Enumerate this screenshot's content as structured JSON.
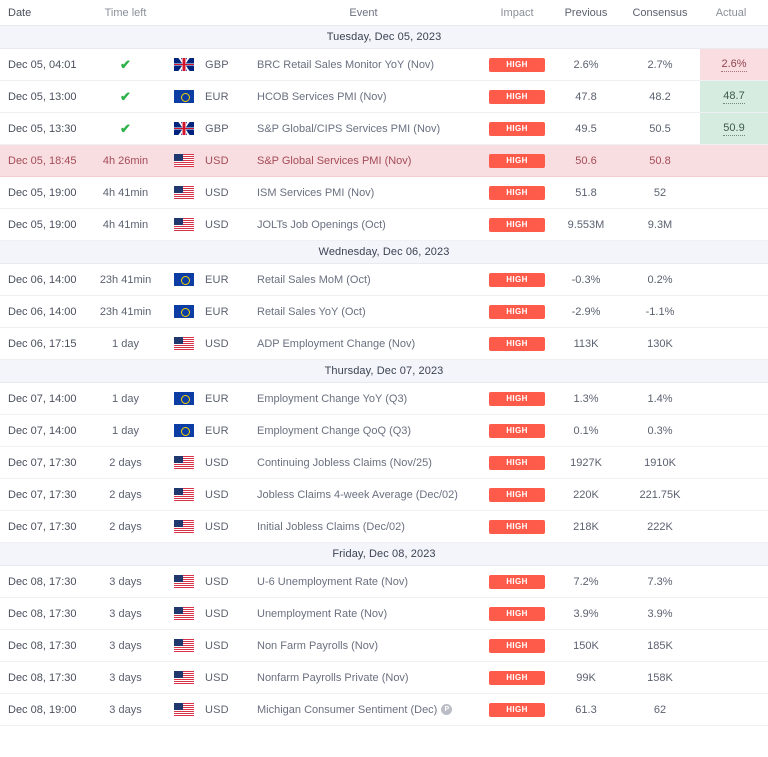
{
  "table": {
    "columns": {
      "date": "Date",
      "time_left": "Time left",
      "event": "Event",
      "impact": "Impact",
      "previous": "Previous",
      "consensus": "Consensus",
      "actual": "Actual"
    }
  },
  "colors": {
    "impact_high_badge": "#ff5b4a",
    "highlight_row_bg": "#f9dee1",
    "actual_beat_bg": "#d6ece1",
    "actual_miss_bg": "#fadde0",
    "day_separator_bg": "#f3f5fa",
    "check_green": "#2fb34a"
  },
  "sections": [
    {
      "day_label": "Tuesday, Dec 05, 2023",
      "rows": [
        {
          "date": "Dec 05, 04:01",
          "time_left": "",
          "released": true,
          "flag": "gb-flag-icon",
          "currency": "GBP",
          "event": "BRC Retail Sales Monitor YoY (Nov)",
          "impact": "HIGH",
          "previous": "2.6%",
          "consensus": "2.7%",
          "actual": "2.6%",
          "actual_state": "miss",
          "prelim": false,
          "highlight": false
        },
        {
          "date": "Dec 05, 13:00",
          "time_left": "",
          "released": true,
          "flag": "eu-flag-icon",
          "currency": "EUR",
          "event": "HCOB Services PMI (Nov)",
          "impact": "HIGH",
          "previous": "47.8",
          "consensus": "48.2",
          "actual": "48.7",
          "actual_state": "beat",
          "prelim": false,
          "highlight": false
        },
        {
          "date": "Dec 05, 13:30",
          "time_left": "",
          "released": true,
          "flag": "gb-flag-icon",
          "currency": "GBP",
          "event": "S&P Global/CIPS Services PMI (Nov)",
          "impact": "HIGH",
          "previous": "49.5",
          "consensus": "50.5",
          "actual": "50.9",
          "actual_state": "beat",
          "prelim": false,
          "highlight": false
        },
        {
          "date": "Dec 05, 18:45",
          "time_left": "4h 26min",
          "released": false,
          "flag": "us-flag-icon",
          "currency": "USD",
          "event": "S&P Global Services PMI (Nov)",
          "impact": "HIGH",
          "previous": "50.6",
          "consensus": "50.8",
          "actual": "",
          "actual_state": "blank",
          "prelim": false,
          "highlight": true
        },
        {
          "date": "Dec 05, 19:00",
          "time_left": "4h 41min",
          "released": false,
          "flag": "us-flag-icon",
          "currency": "USD",
          "event": "ISM Services PMI (Nov)",
          "impact": "HIGH",
          "previous": "51.8",
          "consensus": "52",
          "actual": "",
          "actual_state": "blank",
          "prelim": false,
          "highlight": false
        },
        {
          "date": "Dec 05, 19:00",
          "time_left": "4h 41min",
          "released": false,
          "flag": "us-flag-icon",
          "currency": "USD",
          "event": "JOLTs Job Openings (Oct)",
          "impact": "HIGH",
          "previous": "9.553M",
          "consensus": "9.3M",
          "actual": "",
          "actual_state": "blank",
          "prelim": false,
          "highlight": false
        }
      ]
    },
    {
      "day_label": "Wednesday, Dec 06, 2023",
      "rows": [
        {
          "date": "Dec 06, 14:00",
          "time_left": "23h 41min",
          "released": false,
          "flag": "eu-flag-icon",
          "currency": "EUR",
          "event": "Retail Sales MoM (Oct)",
          "impact": "HIGH",
          "previous": "-0.3%",
          "consensus": "0.2%",
          "actual": "",
          "actual_state": "blank",
          "prelim": false,
          "highlight": false
        },
        {
          "date": "Dec 06, 14:00",
          "time_left": "23h 41min",
          "released": false,
          "flag": "eu-flag-icon",
          "currency": "EUR",
          "event": "Retail Sales YoY (Oct)",
          "impact": "HIGH",
          "previous": "-2.9%",
          "consensus": "-1.1%",
          "actual": "",
          "actual_state": "blank",
          "prelim": false,
          "highlight": false
        },
        {
          "date": "Dec 06, 17:15",
          "time_left": "1 day",
          "released": false,
          "flag": "us-flag-icon",
          "currency": "USD",
          "event": "ADP Employment Change (Nov)",
          "impact": "HIGH",
          "previous": "113K",
          "consensus": "130K",
          "actual": "",
          "actual_state": "blank",
          "prelim": false,
          "highlight": false
        }
      ]
    },
    {
      "day_label": "Thursday, Dec 07, 2023",
      "rows": [
        {
          "date": "Dec 07, 14:00",
          "time_left": "1 day",
          "released": false,
          "flag": "eu-flag-icon",
          "currency": "EUR",
          "event": "Employment Change YoY (Q3)",
          "impact": "HIGH",
          "previous": "1.3%",
          "consensus": "1.4%",
          "actual": "",
          "actual_state": "blank",
          "prelim": false,
          "highlight": false
        },
        {
          "date": "Dec 07, 14:00",
          "time_left": "1 day",
          "released": false,
          "flag": "eu-flag-icon",
          "currency": "EUR",
          "event": "Employment Change QoQ (Q3)",
          "impact": "HIGH",
          "previous": "0.1%",
          "consensus": "0.3%",
          "actual": "",
          "actual_state": "blank",
          "prelim": false,
          "highlight": false
        },
        {
          "date": "Dec 07, 17:30",
          "time_left": "2 days",
          "released": false,
          "flag": "us-flag-icon",
          "currency": "USD",
          "event": "Continuing Jobless Claims (Nov/25)",
          "impact": "HIGH",
          "previous": "1927K",
          "consensus": "1910K",
          "actual": "",
          "actual_state": "blank",
          "prelim": false,
          "highlight": false
        },
        {
          "date": "Dec 07, 17:30",
          "time_left": "2 days",
          "released": false,
          "flag": "us-flag-icon",
          "currency": "USD",
          "event": "Jobless Claims 4-week Average (Dec/02)",
          "impact": "HIGH",
          "previous": "220K",
          "consensus": "221.75K",
          "actual": "",
          "actual_state": "blank",
          "prelim": false,
          "highlight": false
        },
        {
          "date": "Dec 07, 17:30",
          "time_left": "2 days",
          "released": false,
          "flag": "us-flag-icon",
          "currency": "USD",
          "event": "Initial Jobless Claims (Dec/02)",
          "impact": "HIGH",
          "previous": "218K",
          "consensus": "222K",
          "actual": "",
          "actual_state": "blank",
          "prelim": false,
          "highlight": false
        }
      ]
    },
    {
      "day_label": "Friday, Dec 08, 2023",
      "rows": [
        {
          "date": "Dec 08, 17:30",
          "time_left": "3 days",
          "released": false,
          "flag": "us-flag-icon",
          "currency": "USD",
          "event": "U-6 Unemployment Rate (Nov)",
          "impact": "HIGH",
          "previous": "7.2%",
          "consensus": "7.3%",
          "actual": "",
          "actual_state": "blank",
          "prelim": false,
          "highlight": false
        },
        {
          "date": "Dec 08, 17:30",
          "time_left": "3 days",
          "released": false,
          "flag": "us-flag-icon",
          "currency": "USD",
          "event": "Unemployment Rate (Nov)",
          "impact": "HIGH",
          "previous": "3.9%",
          "consensus": "3.9%",
          "actual": "",
          "actual_state": "blank",
          "prelim": false,
          "highlight": false
        },
        {
          "date": "Dec 08, 17:30",
          "time_left": "3 days",
          "released": false,
          "flag": "us-flag-icon",
          "currency": "USD",
          "event": "Non Farm Payrolls (Nov)",
          "impact": "HIGH",
          "previous": "150K",
          "consensus": "185K",
          "actual": "",
          "actual_state": "blank",
          "prelim": false,
          "highlight": false
        },
        {
          "date": "Dec 08, 17:30",
          "time_left": "3 days",
          "released": false,
          "flag": "us-flag-icon",
          "currency": "USD",
          "event": "Nonfarm Payrolls Private (Nov)",
          "impact": "HIGH",
          "previous": "99K",
          "consensus": "158K",
          "actual": "",
          "actual_state": "blank",
          "prelim": false,
          "highlight": false
        },
        {
          "date": "Dec 08, 19:00",
          "time_left": "3 days",
          "released": false,
          "flag": "us-flag-icon",
          "currency": "USD",
          "event": "Michigan Consumer Sentiment (Dec)",
          "impact": "HIGH",
          "previous": "61.3",
          "consensus": "62",
          "actual": "",
          "actual_state": "blank",
          "prelim": true,
          "prelim_label": "P",
          "highlight": false
        }
      ]
    }
  ]
}
